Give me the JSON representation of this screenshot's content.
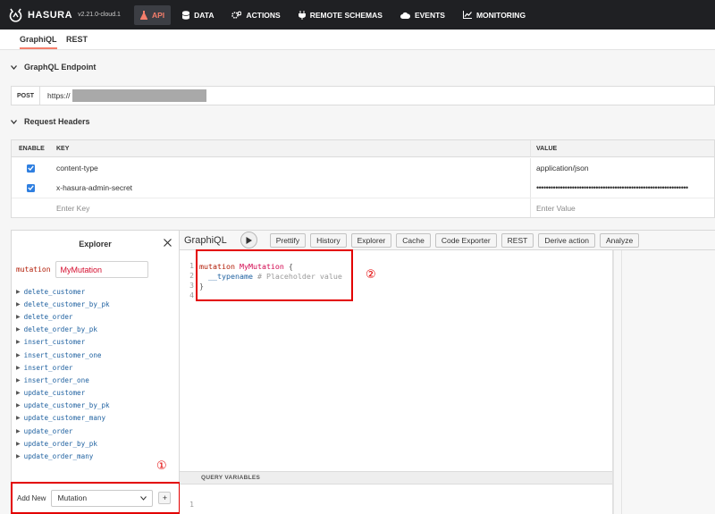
{
  "nav": {
    "brand": "HASURA",
    "version": "v2.21.0-cloud.1",
    "items": [
      {
        "label": "API",
        "icon": "flask-icon",
        "active": true
      },
      {
        "label": "DATA",
        "icon": "database-icon",
        "active": false
      },
      {
        "label": "ACTIONS",
        "icon": "gears-icon",
        "active": false
      },
      {
        "label": "REMOTE SCHEMAS",
        "icon": "plug-icon",
        "active": false
      },
      {
        "label": "EVENTS",
        "icon": "cloud-icon",
        "active": false
      },
      {
        "label": "MONITORING",
        "icon": "chart-icon",
        "active": false
      }
    ]
  },
  "subtabs": [
    {
      "label": "GraphiQL",
      "active": true
    },
    {
      "label": "REST",
      "active": false
    }
  ],
  "endpoint": {
    "section_title": "GraphQL Endpoint",
    "method": "POST",
    "url_prefix": "https://"
  },
  "headers": {
    "section_title": "Request Headers",
    "col_enable": "ENABLE",
    "col_key": "KEY",
    "col_value": "VALUE",
    "rows": [
      {
        "key": "content-type",
        "value": "application/json",
        "enabled": true
      },
      {
        "key": "x-hasura-admin-secret",
        "value": "••••••••••••••••••••••••••••••••••••••••••••••••••••••••••••••••",
        "enabled": true
      }
    ],
    "new_key_placeholder": "Enter Key",
    "new_value_placeholder": "Enter Value"
  },
  "explorer": {
    "title": "Explorer",
    "operation_keyword": "mutation",
    "operation_name": "MyMutation",
    "fields": [
      "delete_customer",
      "delete_customer_by_pk",
      "delete_order",
      "delete_order_by_pk",
      "insert_customer",
      "insert_customer_one",
      "insert_order",
      "insert_order_one",
      "update_customer",
      "update_customer_by_pk",
      "update_customer_many",
      "update_order",
      "update_order_by_pk",
      "update_order_many"
    ],
    "add_new_label": "Add New",
    "add_new_value": "Mutation",
    "add_button": "+",
    "callout": "①"
  },
  "graphiql": {
    "title": "GraphiQL",
    "buttons": [
      "Prettify",
      "History",
      "Explorer",
      "Cache",
      "Code Exporter",
      "REST",
      "Derive action",
      "Analyze"
    ],
    "editor": {
      "line_numbers": [
        "1",
        "2",
        "3",
        "4"
      ],
      "kw": "mutation",
      "name": "MyMutation",
      "open_brace": "{",
      "field": "__typename",
      "comment": "# Placeholder value",
      "close_brace": "}"
    },
    "callout": "②",
    "query_variables_label": "QUERY VARIABLES",
    "qv_line": "1"
  },
  "colors": {
    "nav_bg": "#1f2023",
    "accent": "#f47e6b",
    "annotation_red": "#e30000",
    "checkbox": "#2f7fe0"
  }
}
